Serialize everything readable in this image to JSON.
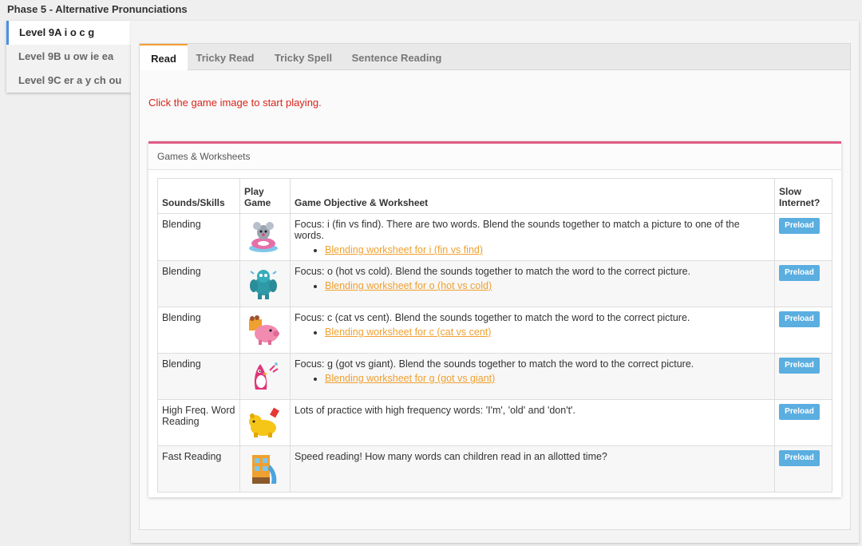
{
  "phase_title": "Phase 5 - Alternative Pronunciations",
  "levels": [
    {
      "label": "Level 9A i o c g",
      "active": true
    },
    {
      "label": "Level 9B u ow ie ea",
      "active": false
    },
    {
      "label": "Level 9C er a y ch ou",
      "active": false
    }
  ],
  "tabs": [
    {
      "label": "Read",
      "active": true
    },
    {
      "label": "Tricky Read",
      "active": false
    },
    {
      "label": "Tricky Spell",
      "active": false
    },
    {
      "label": "Sentence Reading",
      "active": false
    }
  ],
  "instruction": "Click the game image to start playing.",
  "games_panel_title": "Games & Worksheets",
  "table": {
    "headers": {
      "skill": "Sounds/Skills",
      "play": "Play Game",
      "objective": "Game Objective & Worksheet",
      "slow": "Slow Internet?"
    },
    "preload_label": "Preload",
    "rows": [
      {
        "skill": "Blending",
        "icon": "mouse-on-ring-icon",
        "objective": "Focus: i (fin vs find). There are two words. Blend the sounds together to match a picture to one of the words.",
        "worksheet": "Blending worksheet for i (fin vs find)"
      },
      {
        "skill": "Blending",
        "icon": "blue-monster-icon",
        "objective": "Focus: o (hot vs cold). Blend the sounds together to match the word to the correct picture.",
        "worksheet": "Blending worksheet for o (hot vs cold)"
      },
      {
        "skill": "Blending",
        "icon": "pink-pig-icon",
        "objective": "Focus: c (cat vs cent). Blend the sounds together to match the word to the correct picture.",
        "worksheet": "Blending worksheet for c (cat vs cent)"
      },
      {
        "skill": "Blending",
        "icon": "pink-bird-icon",
        "objective": "Focus: g (got vs giant). Blend the sounds together to match the word to the correct picture.",
        "worksheet": "Blending worksheet for g (got vs giant)"
      },
      {
        "skill": "High Freq. Word Reading",
        "icon": "yellow-bear-icon",
        "objective": "Lots of practice with high frequency words: 'I'm', 'old' and 'don't'.",
        "worksheet": ""
      },
      {
        "skill": "Fast Reading",
        "icon": "building-slide-icon",
        "objective": "Speed reading! How many words can children read in an allotted time?",
        "worksheet": ""
      }
    ]
  },
  "colors": {
    "accent_tab": "#f0a030",
    "games_border": "#e05a84",
    "instruction": "#d9241c",
    "preload": "#5aaee0",
    "active_level": "#4a90e2"
  }
}
